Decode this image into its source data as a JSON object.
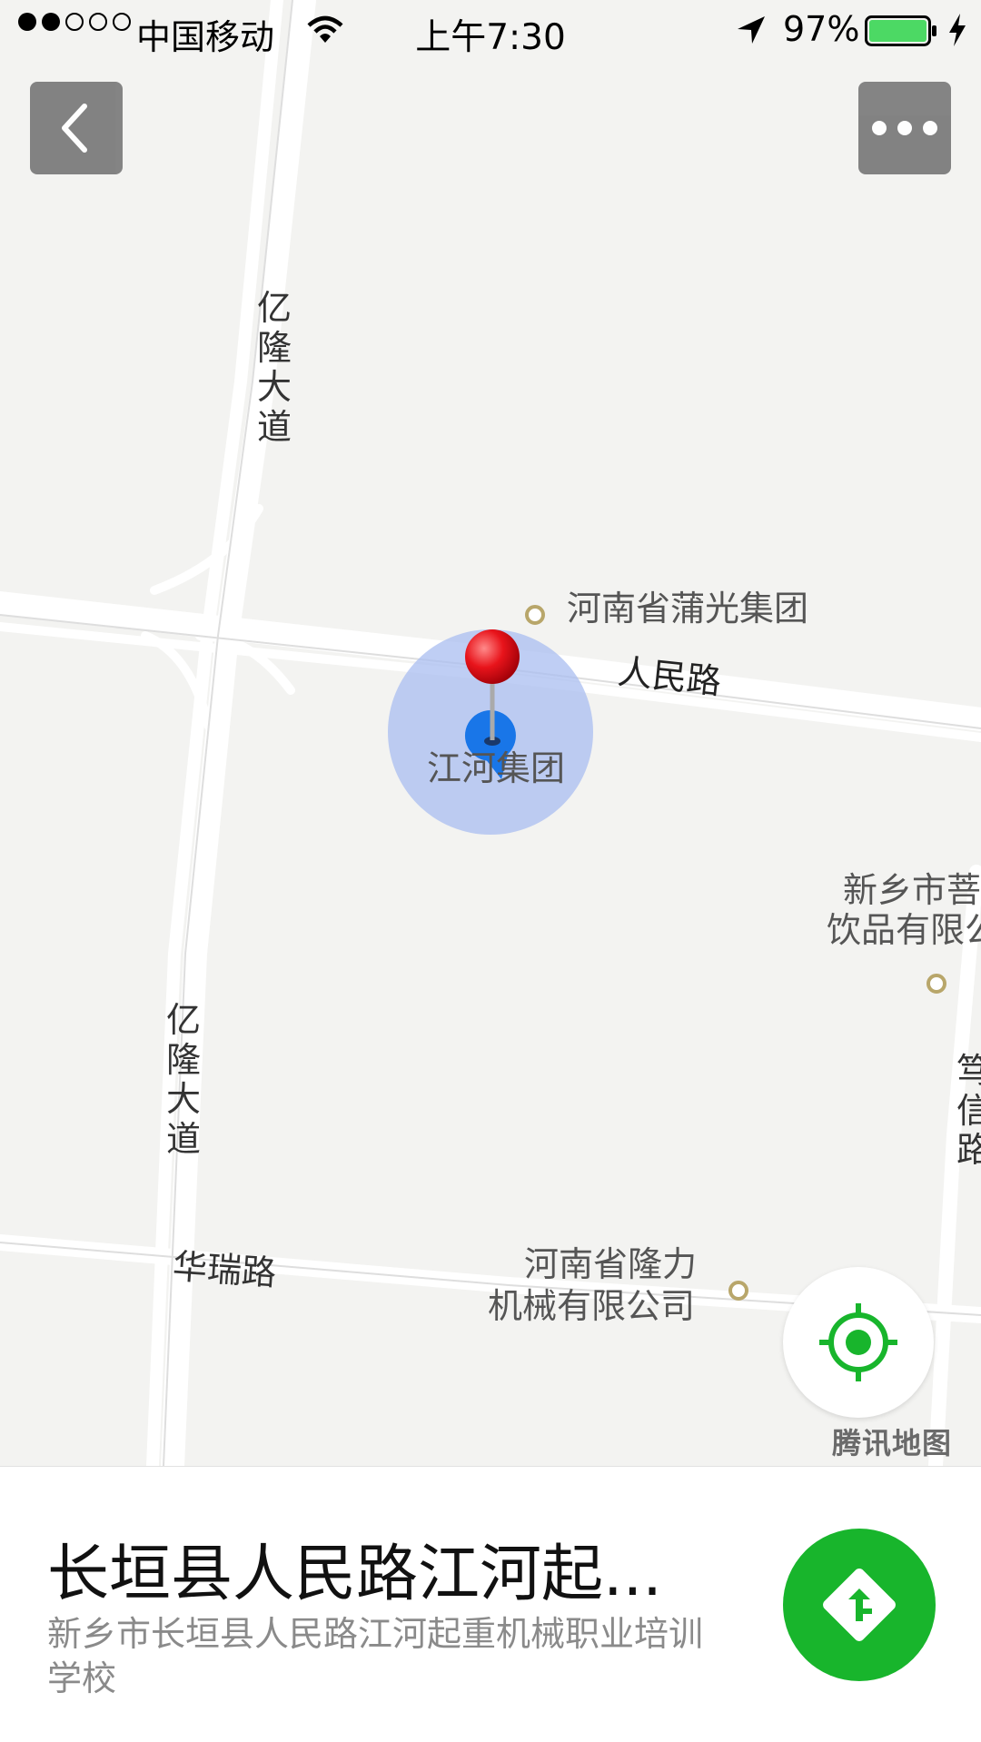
{
  "status_bar": {
    "carrier": "中国移动",
    "time": "上午7:30",
    "battery": "97%",
    "battery_color": "#4cd964"
  },
  "map": {
    "road_labels": {
      "yilong_top": "亿隆大道",
      "yilong_bottom": "亿隆大道",
      "renmin": "人民路",
      "huarui": "华瑞路",
      "right_road": "笃信路"
    },
    "pois": {
      "puguang": "河南省蒲光集团",
      "jianghe": "江河集团",
      "xinxiang_line1": "新乡市菩",
      "xinxiang_line2": "饮品有限公",
      "longli_line1": "河南省隆力",
      "longli_line2": "机械有限公司"
    },
    "provider": "腾讯地图",
    "pin_color": "#e8141b",
    "accuracy_color": "#a9bdf0"
  },
  "icons": {
    "back": "chevron-left-icon",
    "more": "more-dots-icon",
    "locate": "locate-target-icon",
    "route": "route-arrow-icon"
  },
  "panel": {
    "title": "长垣县人民路江河起...",
    "address": "新乡市长垣县人民路江河起重机械职业培训学校",
    "accent": "#18b52c"
  }
}
